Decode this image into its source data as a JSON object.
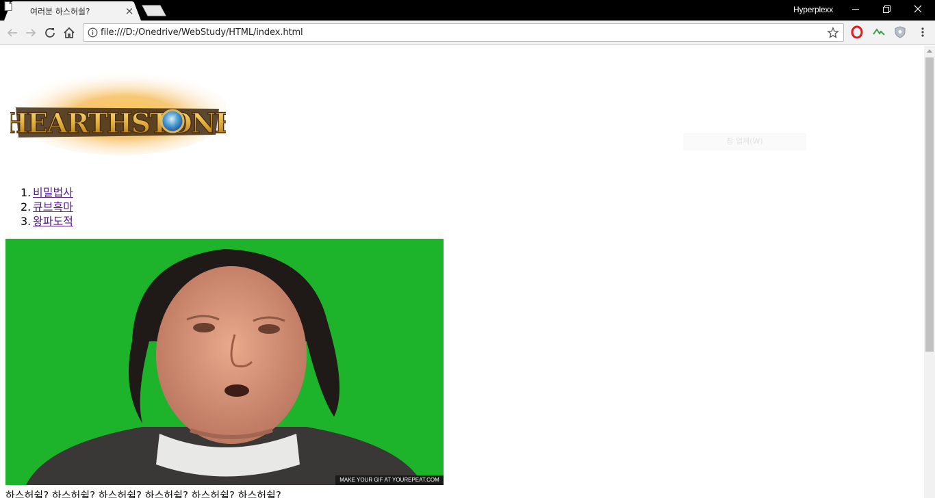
{
  "browser": {
    "tab": {
      "title": "여러분 하스허쉴?",
      "close_glyph": "×"
    },
    "profile_name": "Hyperplexx",
    "window_controls": {
      "minimize": "—",
      "restore": "❐",
      "close": "✕"
    },
    "url": "file:///D:/Onedrive/WebStudy/HTML/index.html",
    "icons": [
      "back-icon",
      "forward-icon",
      "reload-icon",
      "home-icon",
      "info-icon",
      "star-icon",
      "opera-icon",
      "extension-wave-icon",
      "shield-icon",
      "menu-icon"
    ]
  },
  "page": {
    "logo_text": "HEARTHSTONE",
    "faint_placeholder": "창 업체(W)",
    "nav_items": [
      {
        "num": "1.",
        "label": "비밀법사"
      },
      {
        "num": "2.",
        "label": "큐브흑마"
      },
      {
        "num": "3.",
        "label": "왕파도적"
      }
    ],
    "gif_caption": "MAKE YOUR GIF AT YOUREPEAT.COM",
    "bottom_text": "하스허쉴? 하스허쉴? 하스허쉴? 하스허쉴? 하스허쉴? 하스허쉴?"
  },
  "colors": {
    "titlebar": "#000000",
    "link": "#551a8b",
    "gif_background": "#1db32b"
  }
}
